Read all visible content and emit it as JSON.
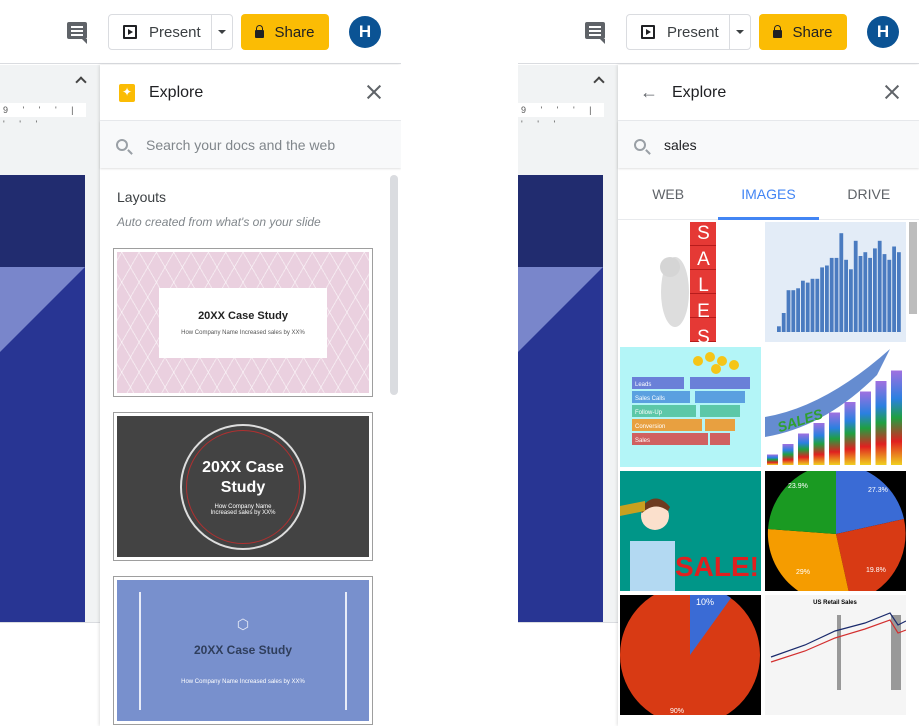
{
  "toolbar": {
    "present_label": "Present",
    "share_label": "Share",
    "avatar_initial": "H"
  },
  "ruler": {
    "mark": "9"
  },
  "left_panel": {
    "title": "Explore",
    "search_placeholder": "Search your docs and the web",
    "section_title": "Layouts",
    "section_subtitle": "Auto created from what's on your slide",
    "layouts": [
      {
        "title": "20XX Case Study",
        "subtitle": "How Company Name Increased sales by XX%"
      },
      {
        "title": "20XX Case Study",
        "subtitle": "How Company Name Increased sales by XX%"
      },
      {
        "title": "20XX Case Study",
        "subtitle": "How Company Name Increased sales by XX%"
      }
    ]
  },
  "right_panel": {
    "title": "Explore",
    "search_value": "sales",
    "tabs": [
      {
        "label": "WEB"
      },
      {
        "label": "IMAGES",
        "active": true
      },
      {
        "label": "DRIVE"
      }
    ],
    "images": [
      {
        "name": "sales-cubes-figure",
        "text": "SALES"
      },
      {
        "name": "quarterly-bar-chart"
      },
      {
        "name": "sales-funnel",
        "labels": [
          "Leads",
          "Sales Calls",
          "Follow-Up",
          "Conversion",
          "Sales"
        ]
      },
      {
        "name": "sales-growth-bars",
        "text": "SALES"
      },
      {
        "name": "sale-man",
        "text": "SALE!"
      },
      {
        "name": "four-slice-pie",
        "labels": [
          "23.9%",
          "27.3%",
          "29%",
          "19.8%"
        ]
      },
      {
        "name": "two-slice-pie",
        "labels": [
          "10%",
          "90%"
        ]
      },
      {
        "name": "us-retail-sales-chart",
        "text": "US Retail Sales"
      }
    ]
  },
  "colors": {
    "share": "#fbbc04",
    "avatar": "#0b5394",
    "active_tab": "#4285f4",
    "slide": "#283593"
  }
}
